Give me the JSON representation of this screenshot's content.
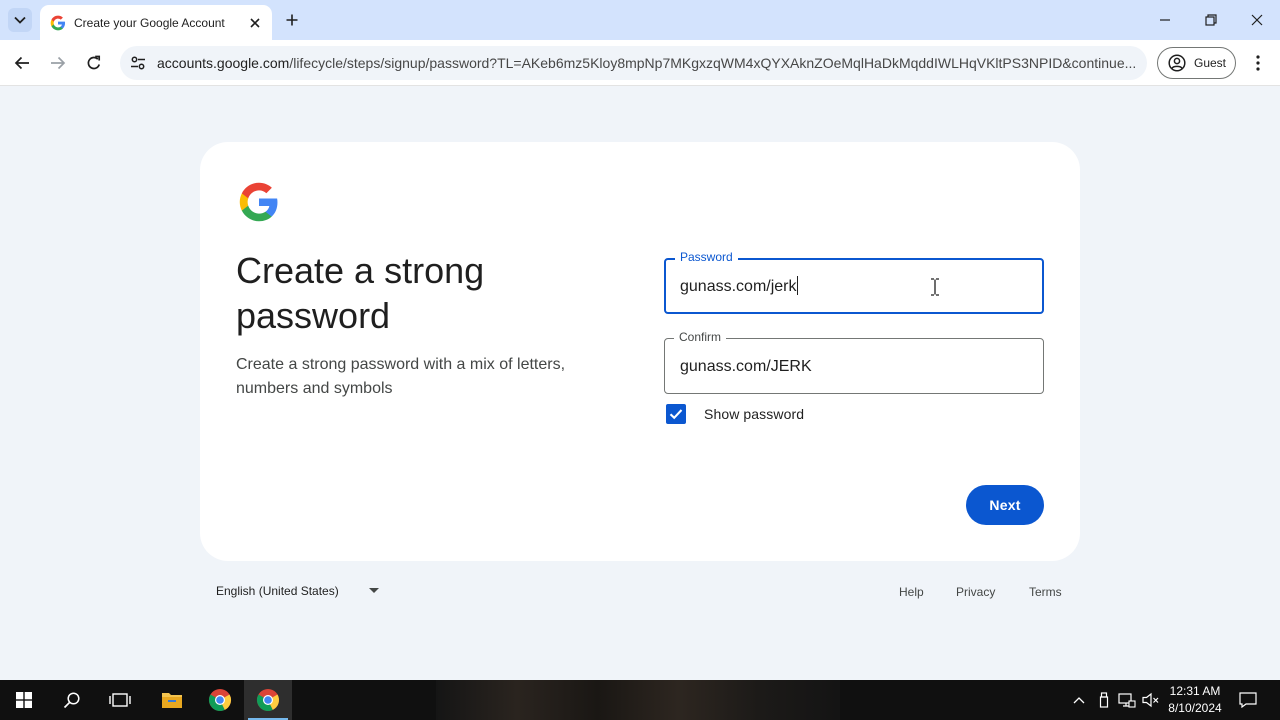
{
  "browser": {
    "tab_title": "Create your Google Account",
    "url_host": "accounts.google.com",
    "url_rest": "/lifecycle/steps/signup/password?TL=AKeb6mz5Kloy8mpNp7MKgxzqWM4xQYXAknZOeMqlHaDkMqddIWLHqVKltPS3NPID&continue...",
    "profile_label": "Guest"
  },
  "page": {
    "headline": "Create a strong password",
    "subtext": "Create a strong password with a mix of letters, numbers and symbols",
    "password_label": "Password",
    "password_value": "gunass.com/jerk",
    "confirm_label": "Confirm",
    "confirm_value": "gunass.com/JERK",
    "show_password_label": "Show password",
    "show_password_checked": true,
    "next_label": "Next"
  },
  "footer": {
    "language": "English (United States)",
    "help": "Help",
    "privacy": "Privacy",
    "terms": "Terms"
  },
  "taskbar": {
    "time": "12:31 AM",
    "date": "8/10/2024"
  },
  "colors": {
    "accent": "#0b57d0",
    "page_bg": "#f0f4f9",
    "tabstrip": "#d3e3fd"
  },
  "icons": [
    "tab-list-icon",
    "google-favicon",
    "close-icon",
    "plus-icon",
    "minimize-icon",
    "restore-icon",
    "window-close-icon",
    "back-arrow-icon",
    "forward-arrow-icon",
    "reload-icon",
    "site-info-icon",
    "guest-profile-icon",
    "more-vert-icon",
    "google-g-logo",
    "checkmark-icon",
    "text-cursor-icon",
    "dropdown-arrow-icon",
    "windows-start-icon",
    "search-icon",
    "task-view-icon",
    "file-explorer-icon",
    "chrome-icon",
    "chevron-up-icon",
    "usb-icon",
    "network-icon",
    "volume-muted-icon",
    "notification-icon"
  ]
}
